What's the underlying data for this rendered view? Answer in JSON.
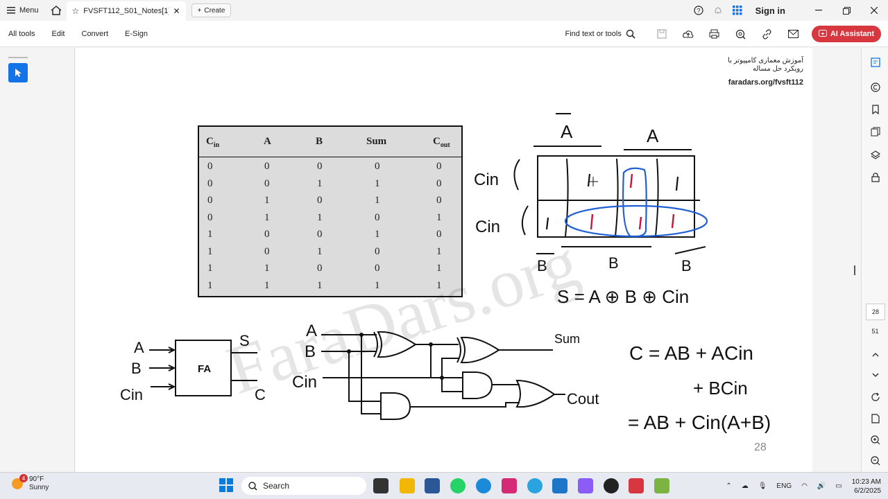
{
  "browser": {
    "menu_label": "Menu",
    "tab_title": "FVSFT112_S01_Notes[1]...",
    "create_label": "Create",
    "signin_label": "Sign in"
  },
  "toolbar": {
    "items": [
      "All tools",
      "Edit",
      "Convert",
      "E-Sign"
    ],
    "find_label": "Find text or tools",
    "ai_label": "AI Assistant"
  },
  "doc": {
    "header_line1": "آموزش معماری کامپیوتر با",
    "header_line2": "رویکرد حل مساله",
    "url": "faradars.org/fvsft112",
    "page_number": "28",
    "watermark": "FaraDars.org"
  },
  "truth_table": {
    "headers": [
      "C",
      "A",
      "B",
      "Sum",
      "C"
    ],
    "header_subs": [
      "in",
      "",
      "",
      "",
      "out"
    ],
    "rows": [
      [
        "0",
        "0",
        "0",
        "0",
        "0"
      ],
      [
        "0",
        "0",
        "1",
        "1",
        "0"
      ],
      [
        "0",
        "1",
        "0",
        "1",
        "0"
      ],
      [
        "0",
        "1",
        "1",
        "0",
        "1"
      ],
      [
        "1",
        "0",
        "0",
        "1",
        "0"
      ],
      [
        "1",
        "0",
        "1",
        "0",
        "1"
      ],
      [
        "1",
        "1",
        "0",
        "0",
        "1"
      ],
      [
        "1",
        "1",
        "1",
        "1",
        "1"
      ]
    ]
  },
  "sketch": {
    "kmap_top_labels": [
      "A",
      "A"
    ],
    "kmap_left_labels": [
      "Cin",
      "Cin"
    ],
    "kmap_bottom_labels": [
      "B",
      "B",
      "B"
    ],
    "sum_eq": "S = A ⊕ B ⊕ Cin",
    "carry_eq1": "C = AB + ACin",
    "carry_eq2": "+ BCin",
    "carry_eq3": "= AB + Cin(A+B)",
    "fa_label": "FA",
    "fa_inputs": [
      "A",
      "B",
      "Cin"
    ],
    "fa_outputs": [
      "S",
      "C"
    ],
    "circuit_inputs": [
      "A",
      "B",
      "Cin"
    ],
    "circuit_outputs": [
      "Sum",
      "Cout"
    ]
  },
  "sidebar": {
    "current_page": "28",
    "total_pages": "51"
  },
  "taskbar": {
    "badge": "4",
    "temperature": "90°F",
    "condition": "Sunny",
    "search_placeholder": "Search",
    "language": "ENG",
    "time": "10:23 AM",
    "date": "6/2/2025"
  },
  "colors": {
    "accent": "#1473e6",
    "ai_button": "#d7373f",
    "ink_blue": "#1f5fd6",
    "ink_red": "#d0103a"
  }
}
